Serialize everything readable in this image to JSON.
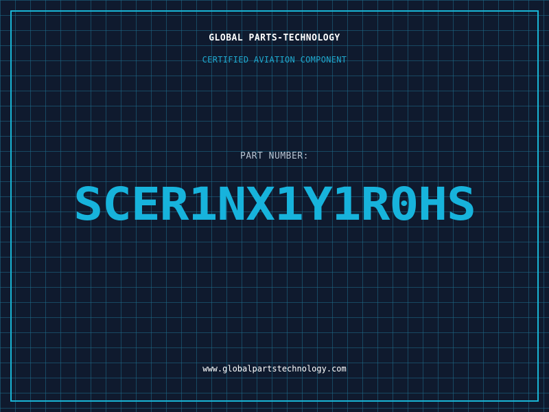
{
  "header": {
    "company_name": "GLOBAL PARTS-TECHNOLOGY",
    "subtitle": "CERTIFIED AVIATION COMPONENT"
  },
  "part": {
    "label": "PART NUMBER:",
    "number": "SCER1NX1Y1R0HS"
  },
  "footer": {
    "website": "www.globalpartstechnology.com"
  },
  "colors": {
    "background": "#0f1a2e",
    "accent": "#19b5d6",
    "grid": "#1e6e8c"
  }
}
